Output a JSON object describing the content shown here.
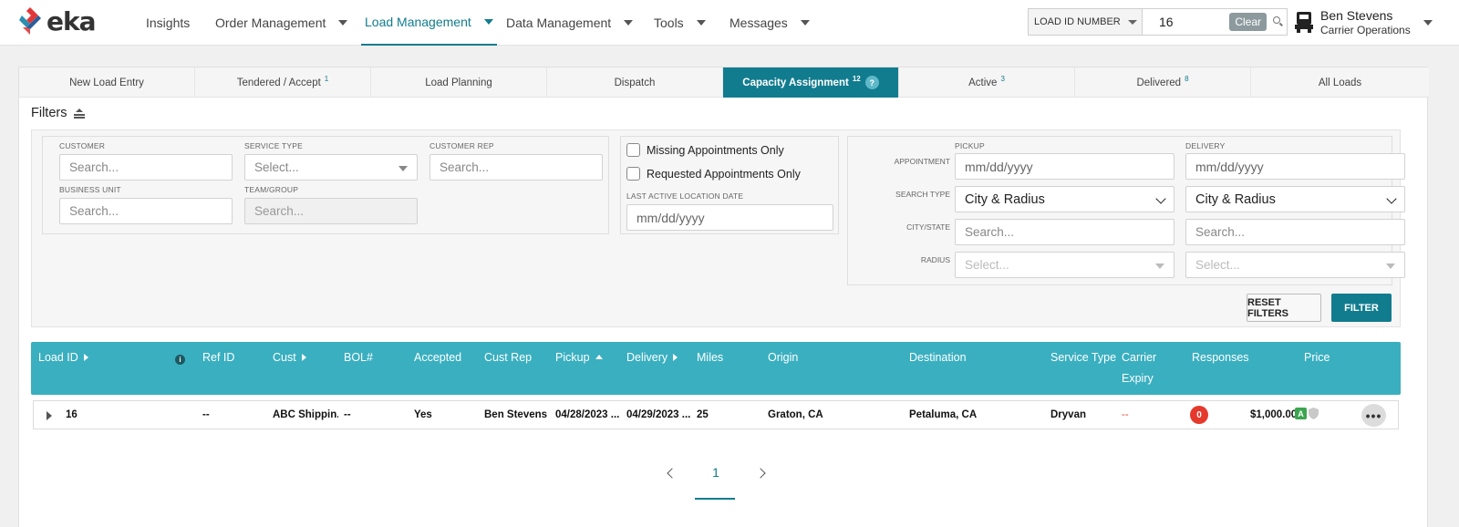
{
  "app": {
    "logo_text": "eka",
    "colors": {
      "accent": "#127c8f",
      "table_header": "#3aafc0",
      "danger": "#e5392c",
      "badge_green": "#3ba550"
    }
  },
  "nav": {
    "items": [
      {
        "label": "Insights"
      },
      {
        "label": "Order Management"
      },
      {
        "label": "Load Management"
      },
      {
        "label": "Data Management"
      },
      {
        "label": "Tools"
      },
      {
        "label": "Messages"
      }
    ],
    "active": "Load Management"
  },
  "search": {
    "type_label": "LOAD ID NUMBER",
    "value": "16",
    "clear_label": "Clear"
  },
  "user": {
    "name": "Ben Stevens",
    "role": "Carrier Operations"
  },
  "tabs": [
    {
      "label": "New Load Entry",
      "count": ""
    },
    {
      "label": "Tendered / Accept",
      "count": "1"
    },
    {
      "label": "Load Planning",
      "count": ""
    },
    {
      "label": "Dispatch",
      "count": ""
    },
    {
      "label": "Capacity Assignment",
      "count": "12",
      "help": "?"
    },
    {
      "label": "Active",
      "count": "3"
    },
    {
      "label": "Delivered",
      "count": "8"
    },
    {
      "label": "All Loads",
      "count": ""
    }
  ],
  "filters": {
    "title": "Filters",
    "customer": {
      "label": "CUSTOMER",
      "placeholder": "Search..."
    },
    "service_type": {
      "label": "SERVICE TYPE",
      "placeholder": "Select..."
    },
    "customer_rep": {
      "label": "CUSTOMER REP",
      "placeholder": "Search..."
    },
    "business_unit": {
      "label": "BUSINESS UNIT",
      "placeholder": "Search..."
    },
    "team_group": {
      "label": "TEAM/GROUP",
      "placeholder": "Search..."
    },
    "missing_appointments": "Missing Appointments Only",
    "requested_appointments": "Requested Appointments Only",
    "last_active_location_date": {
      "label": "LAST ACTIVE LOCATION DATE",
      "placeholder": "mm/dd/yyyy"
    },
    "pickup_label": "PICKUP",
    "delivery_label": "DELIVERY",
    "appointment_label": "APPOINTMENT",
    "search_type_label": "SEARCH TYPE",
    "city_state_label": "CITY/STATE",
    "radius_label": "RADIUS",
    "pickup": {
      "appointment": "mm/dd/yyyy",
      "search_type": "City & Radius",
      "city_state": "Search...",
      "radius": "Select..."
    },
    "delivery": {
      "appointment": "mm/dd/yyyy",
      "search_type": "City & Radius",
      "city_state": "Search...",
      "radius": "Select..."
    },
    "reset_label": "RESET FILTERS",
    "filter_label": "FILTER"
  },
  "table": {
    "columns": [
      "Load ID",
      "Ref ID",
      "Cust",
      "BOL#",
      "Accepted",
      "Cust Rep",
      "Pickup",
      "Delivery",
      "Miles",
      "Origin",
      "Destination",
      "Service Type",
      "Carrier",
      "Expiry",
      "Responses",
      "Price"
    ],
    "info_icon": "i",
    "rows": [
      {
        "load_id": "16",
        "ref_id": "--",
        "cust": "ABC Shippin...",
        "bol": "--",
        "accepted": "Yes",
        "cust_rep": "Ben Stevens",
        "pickup": "04/28/2023 ...",
        "delivery": "04/29/2023 ...",
        "miles": "25",
        "origin": "Graton, CA",
        "destination": "Petaluma, CA",
        "service_type": "Dryvan",
        "carrier_expiry": "--",
        "responses": "0",
        "price": "$1,000.00",
        "price_badge": "A",
        "more": "•••"
      }
    ]
  },
  "pagination": {
    "current": "1"
  }
}
